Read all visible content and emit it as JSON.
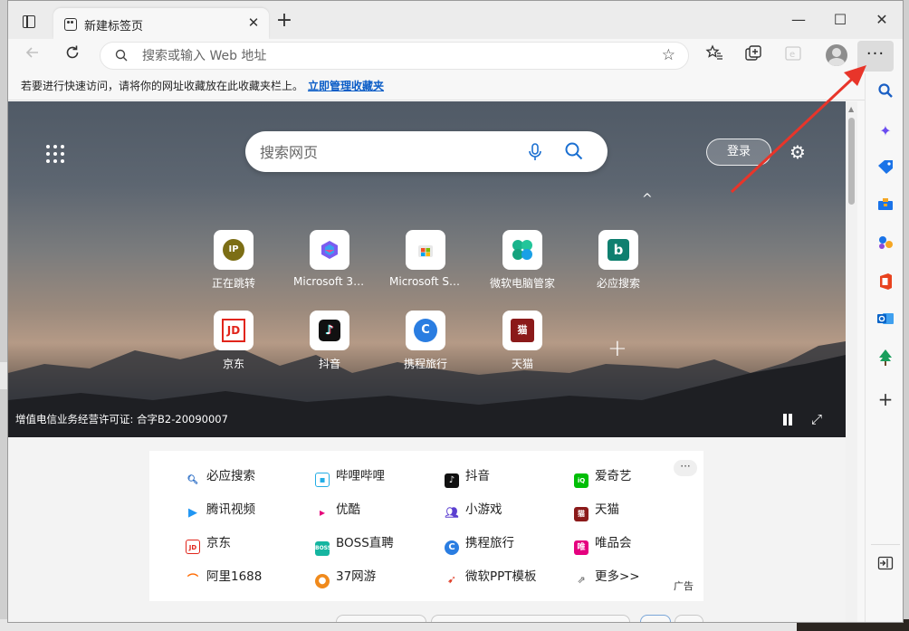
{
  "tab": {
    "title": "新建标签页",
    "close": "✕"
  },
  "window": {
    "new_tab": "+",
    "minimize": "—",
    "maximize": "☐",
    "close": "✕"
  },
  "address": {
    "placeholder": "搜索或输入 Web 地址"
  },
  "favorites_bar": {
    "tip": "若要进行快速访问，请将你的网址收藏放在此收藏夹栏上。",
    "link": "立即管理收藏夹"
  },
  "toolbar": {
    "more": "···"
  },
  "page": {
    "search_placeholder": "搜索网页",
    "login": "登录",
    "collapse": "^",
    "license": "增值电信业务经营许可证: 合字B2-20090007",
    "add_tile": "+"
  },
  "tiles": [
    {
      "label": "正在跳转",
      "icon": "ip-icon",
      "glyph": "IP"
    },
    {
      "label": "Microsoft 365",
      "icon": "m365-icon"
    },
    {
      "label": "Microsoft Sto...",
      "icon": "store-icon"
    },
    {
      "label": "微软电脑管家",
      "icon": "pc-manager-icon"
    },
    {
      "label": "必应搜索",
      "icon": "bing-icon",
      "glyph": "b"
    },
    {
      "label": "京东",
      "icon": "jd-icon",
      "glyph": "JD"
    },
    {
      "label": "抖音",
      "icon": "douyin-icon",
      "glyph": "♪"
    },
    {
      "label": "携程旅行",
      "icon": "ctrip-icon",
      "glyph": "C"
    },
    {
      "label": "天猫",
      "icon": "tmall-icon",
      "glyph": "猫"
    }
  ],
  "quick_links": {
    "more": "···",
    "ad": "广告",
    "items": [
      {
        "label": "必应搜索",
        "icon": "search-icon"
      },
      {
        "label": "哔哩哔哩",
        "icon": "bilibili-icon"
      },
      {
        "label": "抖音",
        "icon": "douyin-icon"
      },
      {
        "label": "爱奇艺",
        "icon": "iqiyi-icon"
      },
      {
        "label": "腾讯视频",
        "icon": "tencent-video-icon"
      },
      {
        "label": "优酷",
        "icon": "youku-icon"
      },
      {
        "label": "小游戏",
        "icon": "game-icon"
      },
      {
        "label": "天猫",
        "icon": "tmall-icon"
      },
      {
        "label": "京东",
        "icon": "jd-icon"
      },
      {
        "label": "BOSS直聘",
        "icon": "boss-icon"
      },
      {
        "label": "携程旅行",
        "icon": "ctrip-icon"
      },
      {
        "label": "唯品会",
        "icon": "vip-icon"
      },
      {
        "label": "阿里1688",
        "icon": "ali1688-icon"
      },
      {
        "label": "37网游",
        "icon": "37game-icon"
      },
      {
        "label": "微软PPT模板",
        "icon": "ppt-icon"
      },
      {
        "label": "更多>>",
        "icon": "more-icon"
      }
    ]
  },
  "colors": {
    "accent": "#0b5dc7",
    "annotation_arrow": "#e8352a"
  }
}
